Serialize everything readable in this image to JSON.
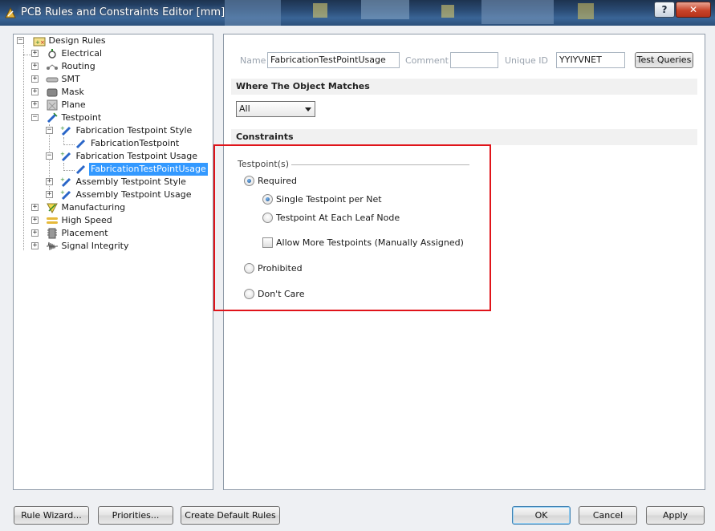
{
  "window": {
    "title": "PCB Rules and Constraints Editor [mm]",
    "help_glyph": "?",
    "close_glyph": "✕"
  },
  "tree": {
    "root": "Design Rules",
    "items": [
      {
        "label": "Electrical",
        "icon": "electrical-icon"
      },
      {
        "label": "Routing",
        "icon": "routing-icon"
      },
      {
        "label": "SMT",
        "icon": "smt-icon"
      },
      {
        "label": "Mask",
        "icon": "mask-icon"
      },
      {
        "label": "Plane",
        "icon": "plane-icon"
      },
      {
        "label": "Testpoint",
        "icon": "testpoint-icon"
      },
      {
        "label": "Fabrication Testpoint Style",
        "icon": "testpoint-rule-icon"
      },
      {
        "label": "FabricationTestpoint",
        "icon": "testpoint-rule-icon"
      },
      {
        "label": "Fabrication Testpoint Usage",
        "icon": "testpoint-rule-icon"
      },
      {
        "label": "FabricationTestPointUsage",
        "icon": "testpoint-rule-icon"
      },
      {
        "label": "Assembly Testpoint Style",
        "icon": "testpoint-rule-icon"
      },
      {
        "label": "Assembly Testpoint Usage",
        "icon": "testpoint-rule-icon"
      },
      {
        "label": "Manufacturing",
        "icon": "manufacturing-icon"
      },
      {
        "label": "High Speed",
        "icon": "high-speed-icon"
      },
      {
        "label": "Placement",
        "icon": "placement-icon"
      },
      {
        "label": "Signal Integrity",
        "icon": "signal-integrity-icon"
      }
    ]
  },
  "rule": {
    "name_label": "Name",
    "name_value": "FabricationTestPointUsage",
    "comment_label": "Comment",
    "comment_value": "",
    "unique_id_label": "Unique ID",
    "unique_id_value": "YYIYVNET",
    "test_queries_label": "Test Queries"
  },
  "where": {
    "header": "Where The Object Matches",
    "selected": "All"
  },
  "constraints": {
    "header": "Constraints",
    "group_title": "Testpoint(s)",
    "required": "Required",
    "single": "Single Testpoint per Net",
    "each_leaf": "Testpoint At Each Leaf Node",
    "allow_more": "Allow More Testpoints (Manually Assigned)",
    "prohibited": "Prohibited",
    "dont_care": "Don't Care"
  },
  "buttons": {
    "rule_wizard": "Rule Wizard...",
    "priorities": "Priorities...",
    "create_default": "Create Default Rules",
    "ok": "OK",
    "cancel": "Cancel",
    "apply": "Apply"
  },
  "colors": {
    "selection": "#3399ff",
    "highlight_box": "#e0141a",
    "titlebar": "#2a4b74"
  }
}
